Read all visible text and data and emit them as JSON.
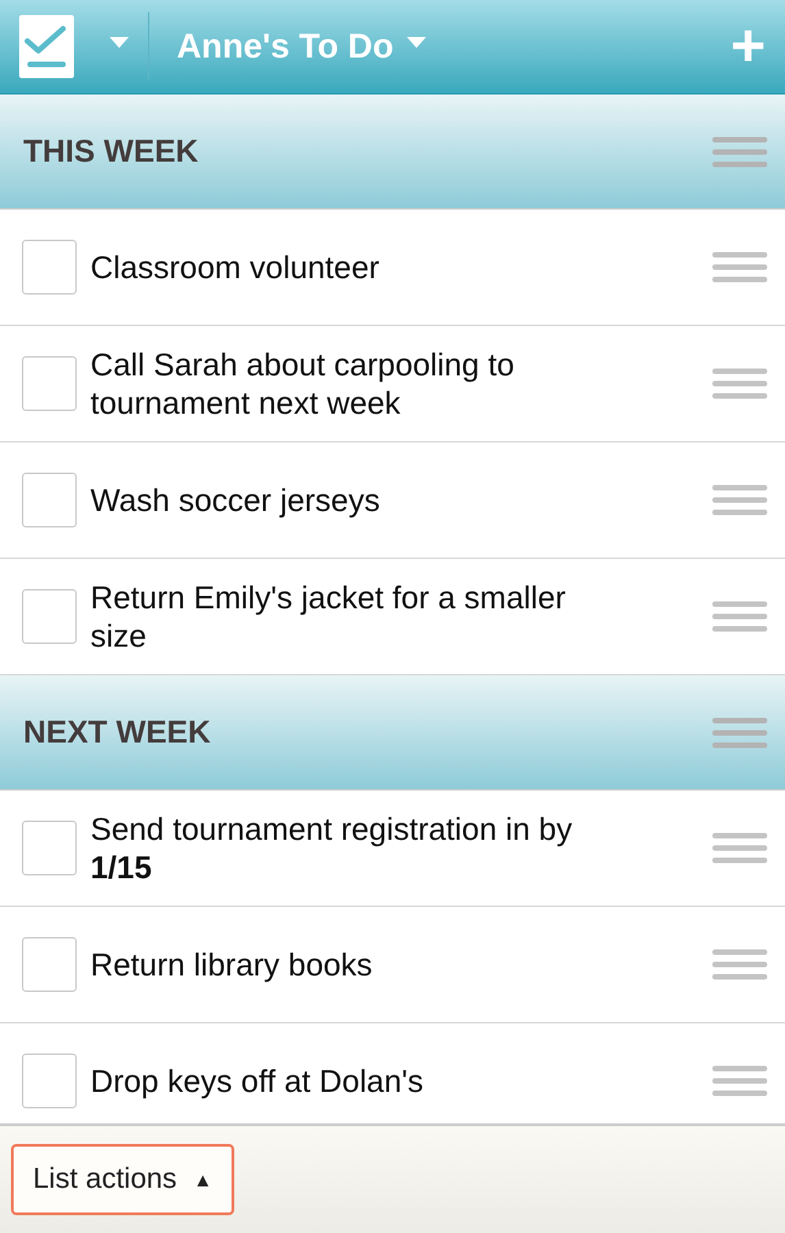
{
  "header": {
    "list_title": "Anne's To Do",
    "add_button": "+"
  },
  "sections": [
    {
      "title": "THIS WEEK",
      "items": [
        {
          "text": "Classroom volunteer",
          "checked": false
        },
        {
          "text": "Call Sarah about carpooling to tournament next week",
          "checked": false
        },
        {
          "text": "Wash soccer jerseys",
          "checked": false
        },
        {
          "text": "Return Emily's jacket for a smaller size",
          "checked": false
        }
      ]
    },
    {
      "title": "NEXT WEEK",
      "items": [
        {
          "text": "Send tournament registration in by **1/15**",
          "checked": false
        },
        {
          "text": "Return library books",
          "checked": false
        },
        {
          "text": "Drop keys off at Dolan's",
          "checked": false
        }
      ]
    }
  ],
  "bottom_bar": {
    "button": "List actions",
    "button_arrow": "▲"
  }
}
